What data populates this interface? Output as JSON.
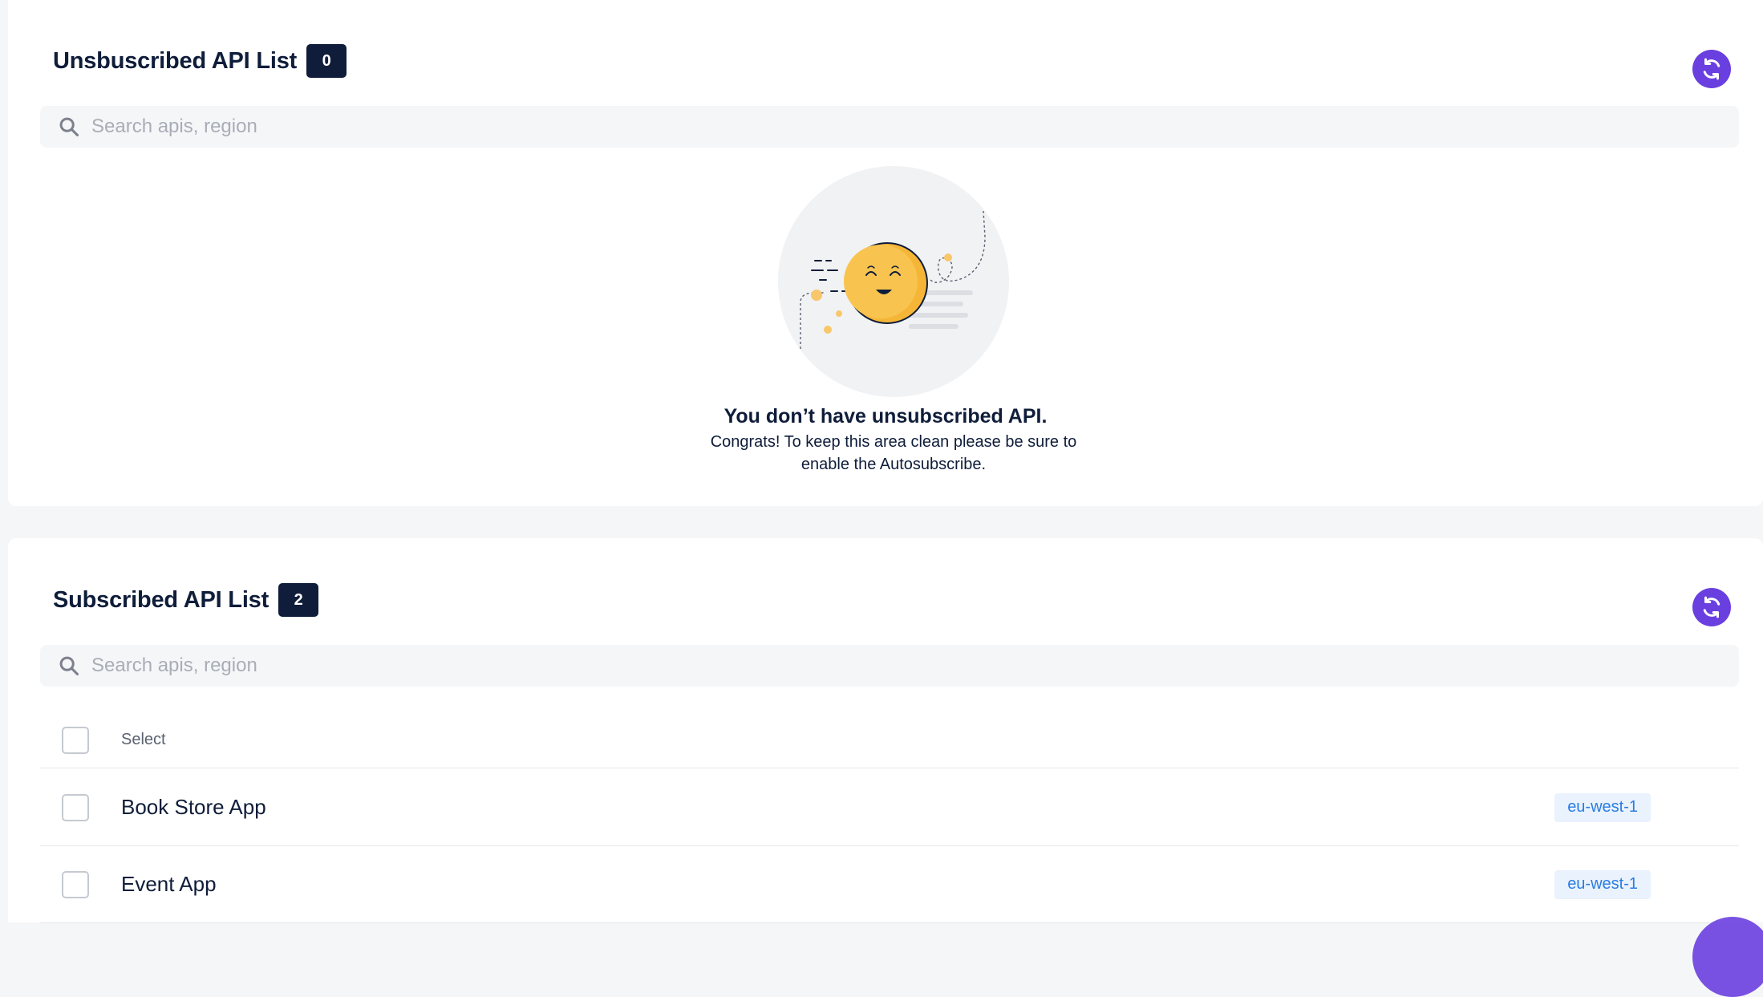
{
  "unsubscribed": {
    "title": "Unsbuscribed API List",
    "count": "0",
    "search_placeholder": "Search apis, region",
    "empty_title": "You don’t have unsubscribed API.",
    "empty_subtitle": "Congrats! To keep this area clean please be sure to enable the Autosubscribe."
  },
  "subscribed": {
    "title": "Subscribed API List",
    "count": "2",
    "search_placeholder": "Search apis, region",
    "select_label": "Select",
    "apis": [
      {
        "name": "Book Store App",
        "region": "eu-west-1"
      },
      {
        "name": "Event App",
        "region": "eu-west-1"
      }
    ]
  },
  "icons": {
    "refresh": "refresh-icon",
    "search": "search-icon",
    "empty_state": "smiley-illustration"
  },
  "colors": {
    "accent": "#6a3fe0",
    "navy": "#0f1d3a",
    "region_text": "#2a7de1",
    "region_bg": "#e9f2fd"
  }
}
